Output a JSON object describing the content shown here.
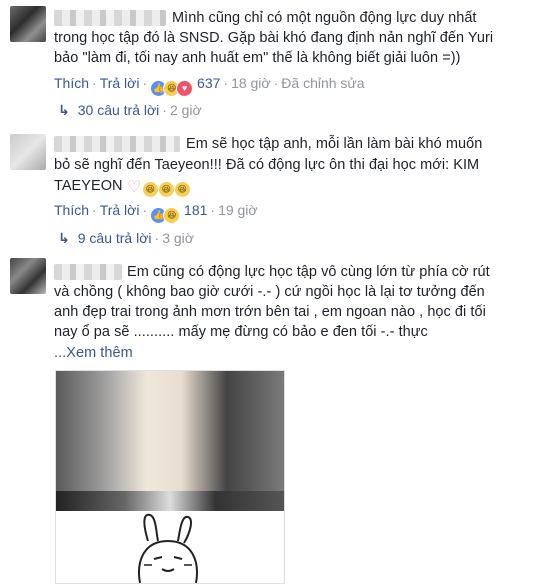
{
  "comments": [
    {
      "lines": [
        "Mình cũng chỉ có một nguồn động lực duy nhất",
        "trong học tập đó là SNSD. Gặp bài khó đang định nản nghĩ đến Yuri",
        "bảo \"làm đi, tối nay anh huất em\" thế là không biết giải luôn =))"
      ],
      "like_label": "Thích",
      "reply_label": "Trả lời",
      "reaction_count": "637",
      "time": "18 giờ",
      "edited": "Đã chỉnh sửa",
      "replies_label": "30 câu trả lời",
      "replies_time": "2 giờ"
    },
    {
      "lines": [
        "Em sẽ học tập anh, mỗi lần làm bài khó muốn",
        "bỏ sẽ nghĩ đến Taeyeon!!! Đã có động lực ôn thi đại học mới: KIM",
        "TAEYEON"
      ],
      "like_label": "Thích",
      "reply_label": "Trả lời",
      "reaction_count": "181",
      "time": "19 giờ",
      "replies_label": "9 câu trả lời",
      "replies_time": "3 giờ"
    },
    {
      "lines": [
        "Em cũng có động lực học tập vô cùng lớn từ phía cờ rút",
        "và chồng ( không bao giờ cưới -.- ) cứ ngồi học là lại tơ tưởng đến",
        "anh đẹp trai trong ảnh mơn trớn bên tai , em ngoan nào , học đi tối",
        "nay ổ pa sẽ .......... mấy mẹ đừng có bảo e đen tối -.- thực"
      ],
      "see_more": "...Xem thêm"
    }
  ]
}
